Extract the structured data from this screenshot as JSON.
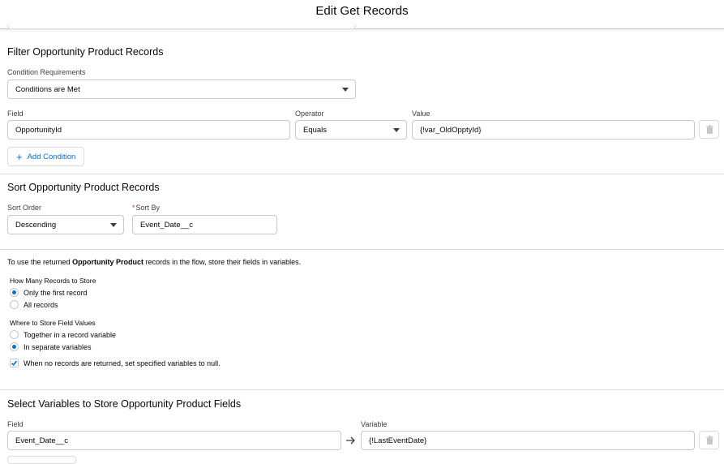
{
  "window": {
    "title": "Edit Get Records"
  },
  "filter": {
    "title": "Filter Opportunity Product Records",
    "condition_requirements_label": "Condition Requirements",
    "condition_requirements_value": "Conditions are Met",
    "field_label": "Field",
    "operator_label": "Operator",
    "value_label": "Value",
    "rows": [
      {
        "field": "OpportunityId",
        "operator": "Equals",
        "value": "{!var_OldOpptyId}"
      }
    ],
    "add_condition_label": "Add Condition"
  },
  "sort": {
    "title": "Sort Opportunity Product Records",
    "order_label": "Sort Order",
    "order_value": "Descending",
    "required_mark": "*",
    "by_label": "Sort By",
    "by_value": "Event_Date__c"
  },
  "store": {
    "intro_pre": "To use the returned ",
    "intro_bold": "Opportunity Product",
    "intro_post": " records in the flow, store their fields in variables.",
    "how_many_label": "How Many Records to Store",
    "how_many_options": [
      {
        "label": "Only the first record",
        "selected": true
      },
      {
        "label": "All records",
        "selected": false
      }
    ],
    "where_label": "Where to Store Field Values",
    "where_options": [
      {
        "label": "Together in a record variable",
        "selected": false
      },
      {
        "label": "In separate variables",
        "selected": true
      }
    ],
    "null_checkbox_label": "When no records are returned, set specified variables to null.",
    "null_checkbox_checked": true
  },
  "variables": {
    "title": "Select Variables to Store Opportunity Product Fields",
    "field_label": "Field",
    "variable_label": "Variable",
    "rows": [
      {
        "field": "Event_Date__c",
        "variable": "{!LastEventDate}"
      }
    ]
  },
  "colors": {
    "brand": "#0070d2",
    "border": "#c9c7c5",
    "required": "#c23934"
  }
}
